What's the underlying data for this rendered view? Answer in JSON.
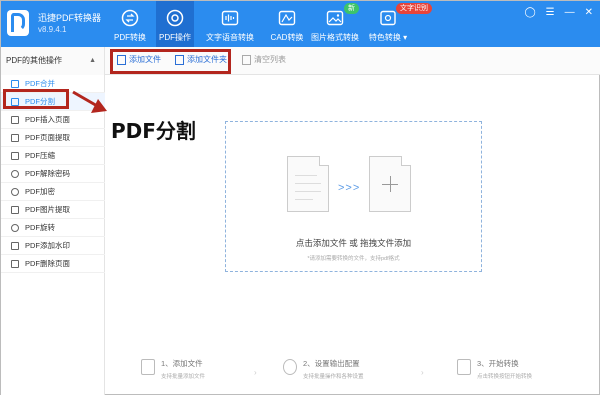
{
  "app": {
    "name": "迅捷PDF转换器",
    "version": "v8.9.4.1"
  },
  "nav": [
    {
      "label": "PDF转换",
      "icon": "convert-icon"
    },
    {
      "label": "PDF操作",
      "icon": "target-icon"
    },
    {
      "label": "文字语音转换",
      "icon": "audio-icon"
    },
    {
      "label": "CAD转换",
      "icon": "cad-icon"
    },
    {
      "label": "图片格式转换",
      "icon": "image-icon"
    },
    {
      "label": "特色转换 ▾",
      "icon": "gear-icon"
    }
  ],
  "badges": {
    "new": "新",
    "ocr": "文字识别"
  },
  "toolbar": {
    "add_file": "添加文件",
    "add_folder": "添加文件夹",
    "clear_list": "清空列表"
  },
  "sidebar": {
    "header": "PDF的其他操作",
    "items": [
      {
        "label": "PDF合并"
      },
      {
        "label": "PDF分割"
      },
      {
        "label": "PDF插入页面"
      },
      {
        "label": "PDF页面提取"
      },
      {
        "label": "PDF压缩"
      },
      {
        "label": "PDF解除密码"
      },
      {
        "label": "PDF加密"
      },
      {
        "label": "PDF图片提取"
      },
      {
        "label": "PDF旋转"
      },
      {
        "label": "PDF添加水印"
      },
      {
        "label": "PDF删除页面"
      }
    ]
  },
  "annotation_title": "PDF分割",
  "dropzone": {
    "main": "点击添加文件 或 拖拽文件添加",
    "sub": "*请添加需要转换的文件，支持pdf格式"
  },
  "steps": [
    {
      "title": "1、添加文件",
      "sub": "支持批量添加文件"
    },
    {
      "title": "2、设置输出配置",
      "sub": "支持批量操作和各种设置"
    },
    {
      "title": "3、开始转换",
      "sub": "点击转换按钮开始转换"
    }
  ],
  "colors": {
    "header_blue": "#2b8cef",
    "accent_red": "#b3261e"
  }
}
